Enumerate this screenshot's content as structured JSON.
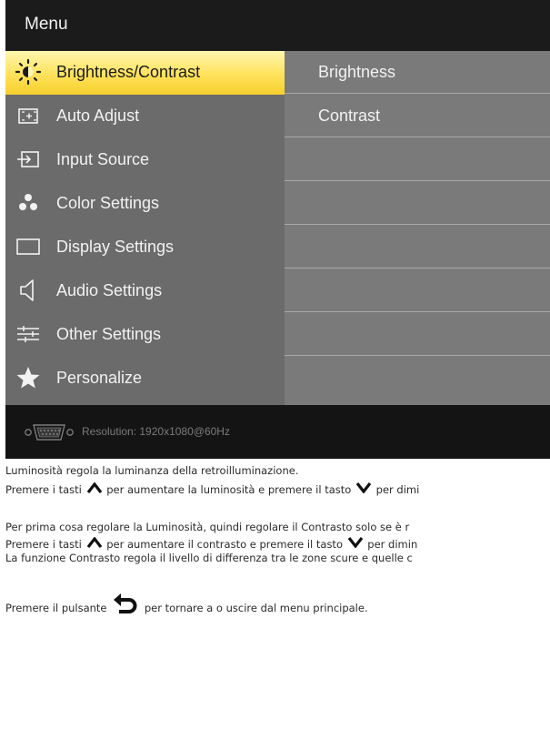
{
  "osd": {
    "title": "Menu",
    "menu_items": [
      {
        "label": "Brightness/Contrast",
        "icon": "brightness-icon",
        "selected": true
      },
      {
        "label": "Auto Adjust",
        "icon": "auto-adjust-icon",
        "selected": false
      },
      {
        "label": "Input Source",
        "icon": "input-source-icon",
        "selected": false
      },
      {
        "label": "Color Settings",
        "icon": "color-settings-icon",
        "selected": false
      },
      {
        "label": "Display Settings",
        "icon": "display-settings-icon",
        "selected": false
      },
      {
        "label": "Audio Settings",
        "icon": "audio-settings-icon",
        "selected": false
      },
      {
        "label": "Other Settings",
        "icon": "other-settings-icon",
        "selected": false
      },
      {
        "label": "Personalize",
        "icon": "personalize-icon",
        "selected": false
      }
    ],
    "sub_items": [
      "Brightness",
      "Contrast",
      "",
      "",
      "",
      "",
      "",
      ""
    ],
    "footer": {
      "resolution": "Resolution:  1920x1080@60Hz",
      "icon": "vga-connector-icon"
    },
    "colors": {
      "selected_highlight": "#ffe25a",
      "menu_bg": "#6b6b6b",
      "sub_bg": "#7a7a7a"
    }
  },
  "doc": {
    "line1": "Luminosità regola la luminanza della retroilluminazione.",
    "line2a": "Premere i tasti",
    "line2b": "per aumentare la luminosità e",
    "line2c": "premere il tasto",
    "line2d": "per dimi",
    "line3": "Per prima cosa regolare la Luminosità, quindi regolare il Contrasto solo se è r",
    "line4a": "Premere i tasti",
    "line4b": "per aumentare il contrasto e premere il tasto",
    "line4c": "per dimin",
    "line5": "La funzione Contrasto regola il livello di differenza tra le zone scure e quelle c",
    "line6a": "Premere il pulsante",
    "line6b": "per tornare a o uscire dal menu principale."
  }
}
